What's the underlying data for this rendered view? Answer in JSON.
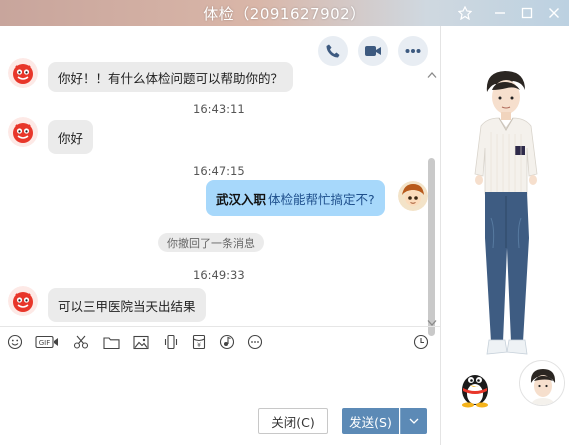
{
  "window": {
    "title": "体检（2091627902）"
  },
  "messages": [
    {
      "kind": "incoming",
      "text": "你好！！有什么体检问题可以帮助你的？"
    },
    {
      "kind": "time",
      "text": "16:43:11"
    },
    {
      "kind": "incoming",
      "text": "你好"
    },
    {
      "kind": "time",
      "text": "16:47:15"
    },
    {
      "kind": "outgoing",
      "bold_text": "武汉入职",
      "text": "体检能帮忙搞定不?"
    },
    {
      "kind": "system",
      "text": "你撤回了一条消息"
    },
    {
      "kind": "time",
      "text": "16:49:33"
    },
    {
      "kind": "incoming",
      "text": "可以三甲医院当天出结果"
    }
  ],
  "toolbar": {
    "gif_label": "GIF"
  },
  "buttons": {
    "close_label": "关闭(C)",
    "send_label": "发送(S)"
  },
  "colors": {
    "self_bubble": "#a7d8fb",
    "other_bubble": "#ebebeb",
    "send_button": "#5c8ab6"
  }
}
